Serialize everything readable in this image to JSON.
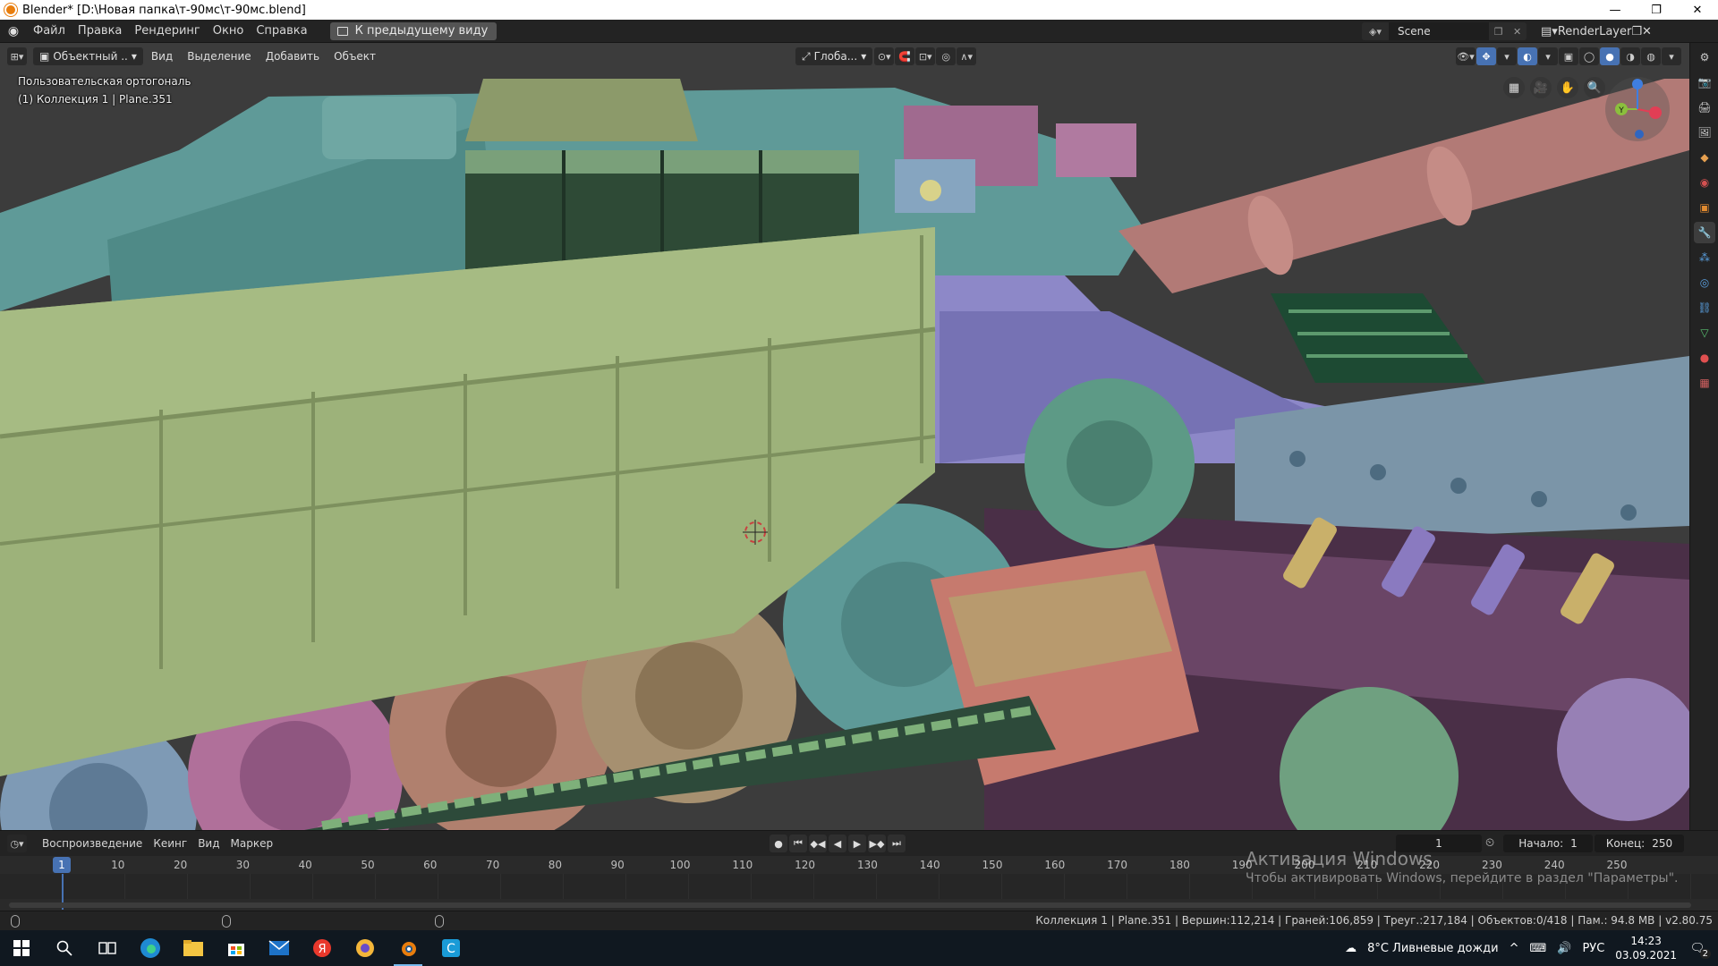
{
  "window": {
    "title": "Blender* [D:\\Новая папка\\т-90мс\\т-90мс.blend]",
    "minimize": "—",
    "restore": "❐",
    "close": "✕"
  },
  "topbar": {
    "menus": [
      "Файл",
      "Правка",
      "Рендеринг",
      "Окно",
      "Справка"
    ],
    "back_button": "К предыдущему виду",
    "scene_name": "Scene",
    "render_layer": "RenderLayer"
  },
  "viewport_header": {
    "mode": "Объектный ..",
    "menus": [
      "Вид",
      "Выделение",
      "Добавить",
      "Объект"
    ],
    "transform_orientation": "Глоба..."
  },
  "viewport_overlay": {
    "view_name": "Пользовательская ортогональ",
    "collection_info": "(1) Коллекция 1 | Plane.351"
  },
  "gizmo": {
    "x_label": "X",
    "y_label": "Y",
    "z_label": "Z"
  },
  "timeline": {
    "menus": [
      "Воспроизведение",
      "Кеинг",
      "Вид",
      "Маркер"
    ],
    "current_frame": "1",
    "start_label": "Начало:",
    "start_value": "1",
    "end_label": "Конец:",
    "end_value": "250",
    "ruler_ticks": [
      "1",
      "10",
      "20",
      "30",
      "40",
      "50",
      "60",
      "70",
      "80",
      "90",
      "100",
      "110",
      "120",
      "130",
      "140",
      "150",
      "160",
      "170",
      "180",
      "190",
      "200",
      "210",
      "220",
      "230",
      "240",
      "250"
    ]
  },
  "watermark": {
    "line1": "Активация Windows",
    "line2": "Чтобы активировать Windows, перейдите в раздел \"Параметры\"."
  },
  "statusbar": {
    "stats": "Коллекция 1 | Plane.351 | Вершин:112,214 | Граней:106,859 | Треуг.:217,184 | Объектов:0/418 | Пам.: 94.8 MB | v2.80.75"
  },
  "taskbar": {
    "weather": "8°C  Ливневые дожди",
    "language": "РУС",
    "time": "14:23",
    "date": "03.09.2021",
    "notifications": "2"
  },
  "colors": {
    "accent": "#4772b3",
    "armor_green": "#9db27a",
    "hull_purple": "#7a5a86",
    "turret_teal": "#5f9a98",
    "barrel_pink": "#b27a76"
  }
}
